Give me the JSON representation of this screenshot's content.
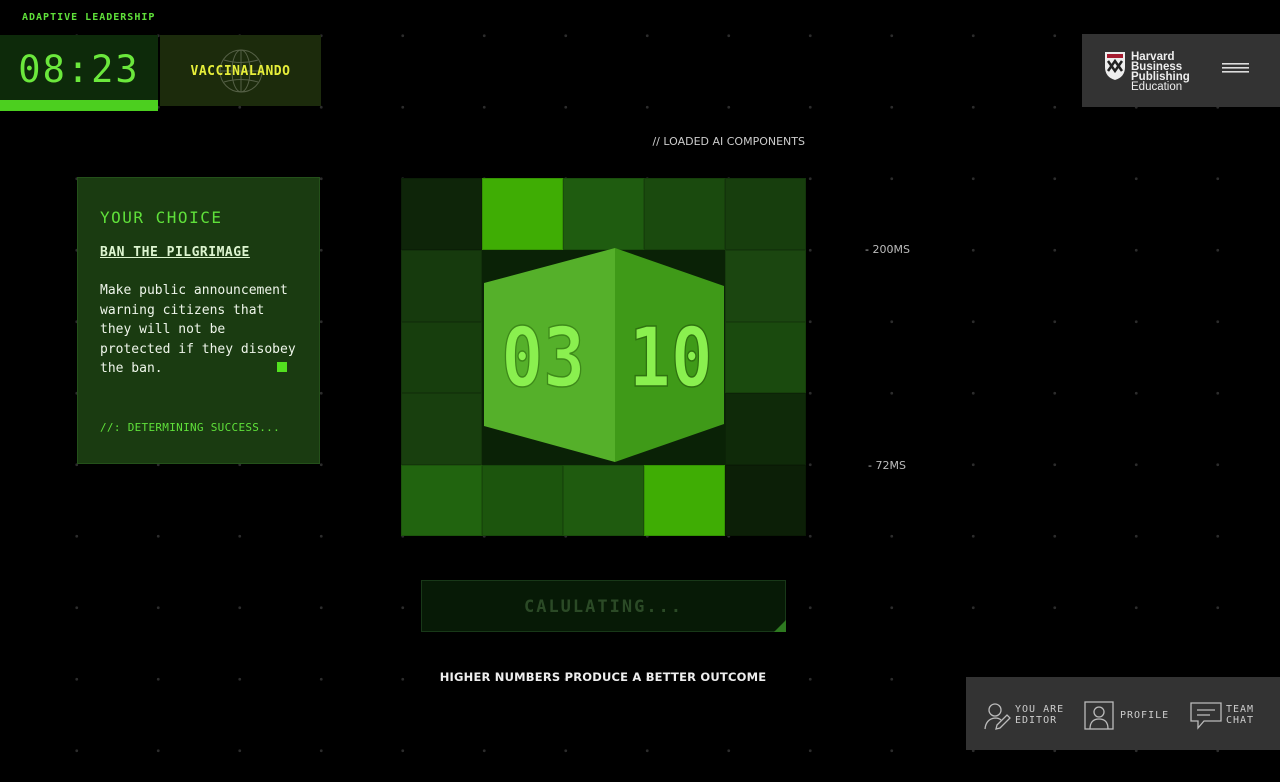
{
  "app": {
    "title": "ADAPTIVE LEADERSHIP"
  },
  "timer": {
    "value": "08:23",
    "progress": 1.0
  },
  "scenario": {
    "label": "VACCINALANDO"
  },
  "brand": {
    "lines": [
      "Harvard",
      "Business",
      "Publishing",
      "Education"
    ]
  },
  "status": {
    "loaded": "// LOADED AI COMPONENTS",
    "ms_high": "- 200MS",
    "ms_low": "- 72MS"
  },
  "choice": {
    "heading": "YOUR CHOICE",
    "name": "BAN THE PILGRIMAGE",
    "description": "Make public announcement warning citizens that they will not be protected if they disobey the ban.",
    "status": "//: DETERMINING SUCCESS..."
  },
  "cube": {
    "left_value": "03",
    "right_value": "10"
  },
  "calculate": {
    "label": "CALULATING..."
  },
  "hint": "HIGHER NUMBERS PRODUCE A BETTER OUTCOME",
  "footer": {
    "editor": [
      "YOU ARE",
      "EDITOR"
    ],
    "profile": "PROFILE",
    "chat": [
      "TEAM",
      "CHAT"
    ]
  },
  "colors": {
    "accent": "#52e01f",
    "scenario_text": "#e6ee3a",
    "panel": "#1a3b11",
    "footer_bg": "#333333"
  },
  "icons": [
    "globe-icon",
    "harvard-shield-icon",
    "hamburger-menu-icon",
    "user-edit-icon",
    "profile-icon",
    "chat-icon"
  ]
}
